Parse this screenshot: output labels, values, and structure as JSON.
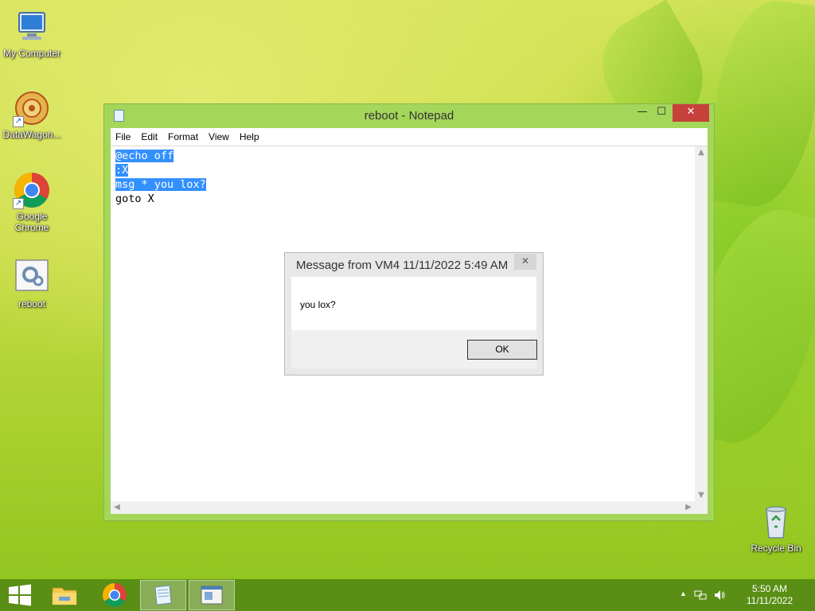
{
  "desktop": {
    "icons": [
      {
        "label": "My Computer"
      },
      {
        "label": "DataWagon..."
      },
      {
        "label": "Google Chrome"
      },
      {
        "label": "reboot"
      },
      {
        "label": "Recycle Bin"
      }
    ]
  },
  "notepad": {
    "title": "reboot - Notepad",
    "controls": {
      "minimize": "—",
      "maximize": "☐",
      "close": "✕"
    },
    "menu": [
      "File",
      "Edit",
      "Format",
      "View",
      "Help"
    ],
    "lines": [
      {
        "text": "@echo off",
        "selected": true
      },
      {
        "text": ":X",
        "selected": true
      },
      {
        "text": "msg * you lox?",
        "selected": true
      },
      {
        "text": "goto X",
        "selected": false
      }
    ]
  },
  "dialog": {
    "title": "Message from VM4 11/11/2022 5:49 AM",
    "close": "✕",
    "message": "you lox?",
    "ok_label": "OK"
  },
  "taskbar": {
    "clock_time": "5:50 AM",
    "clock_date": "11/11/2022",
    "tray_arrow": "▲"
  },
  "colors": {
    "selection": "#3390ff",
    "close_button": "#c7413b",
    "window_frame": "#a4d65a"
  }
}
